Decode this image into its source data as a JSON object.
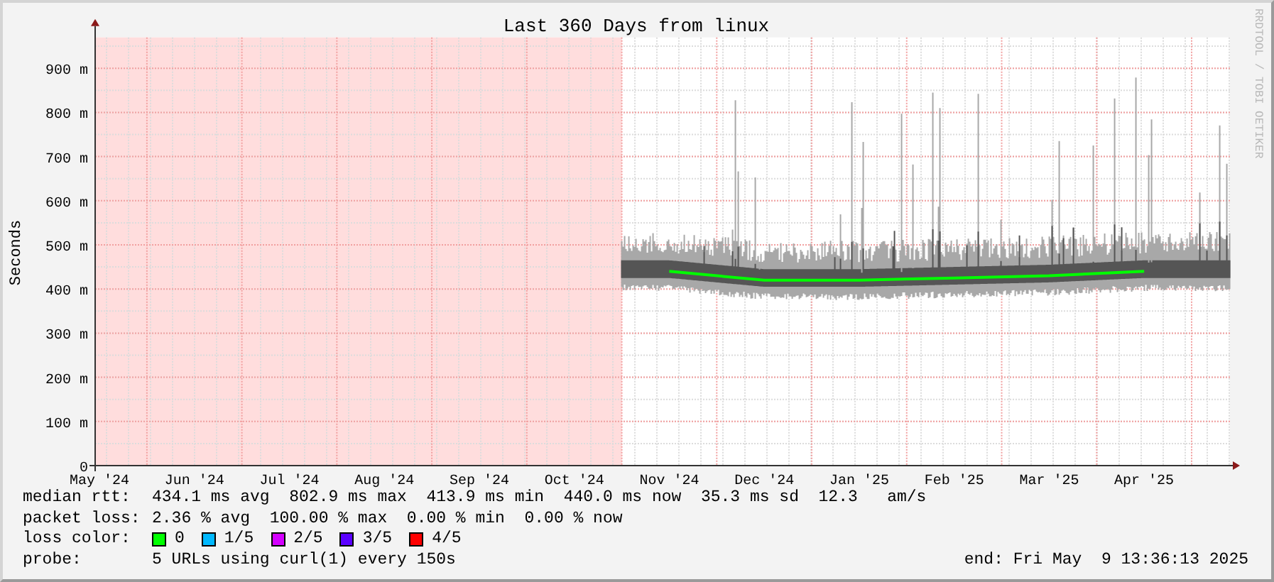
{
  "chart_data": {
    "type": "line",
    "title": "Last 360 Days from linux",
    "ylabel": "Seconds",
    "categories": [
      "May '24",
      "Jun '24",
      "Jul '24",
      "Aug '24",
      "Sep '24",
      "Oct '24",
      "Nov '24",
      "Dec '24",
      "Jan '25",
      "Feb '25",
      "Mar '25",
      "Apr '25"
    ],
    "series": [
      {
        "color": "#00ff00",
        "values": [
          null,
          null,
          null,
          null,
          null,
          null,
          440,
          420,
          420,
          425,
          430,
          440
        ]
      }
    ],
    "ylim": [
      0,
      970
    ],
    "grid": true,
    "yticks": [
      {
        "value": 0,
        "label": "0"
      },
      {
        "value": 100,
        "label": "100 m"
      },
      {
        "value": 200,
        "label": "200 m"
      },
      {
        "value": 300,
        "label": "300 m"
      },
      {
        "value": 400,
        "label": "400 m"
      },
      {
        "value": 500,
        "label": "500 m"
      },
      {
        "value": 600,
        "label": "600 m"
      },
      {
        "value": 700,
        "label": "700 m"
      },
      {
        "value": 800,
        "label": "800 m"
      },
      {
        "value": 900,
        "label": "900 m"
      }
    ]
  },
  "credit": "RRDTOOL / TOBI OETIKER",
  "legend": {
    "median_rtt": {
      "label": "median rtt:",
      "text": "434.1 ms avg  802.9 ms max  413.9 ms min  440.0 ms now  35.3 ms sd  12.3   am/s"
    },
    "packet_loss": {
      "label": "packet loss:",
      "text": "2.36 % avg  100.00 % max  0.00 % min  0.00 % now"
    },
    "loss_color": {
      "label": "loss color:",
      "items": [
        {
          "label": "0",
          "color": "#00ff00"
        },
        {
          "label": "1/5",
          "color": "#00b8ff"
        },
        {
          "label": "2/5",
          "color": "#d400ff"
        },
        {
          "label": "3/5",
          "color": "#5a00ff"
        },
        {
          "label": "4/5",
          "color": "#ff0000"
        }
      ]
    },
    "probe": {
      "label": "probe:",
      "text": "5 URLs using curl(1) every 150s"
    },
    "end": "end: Fri May  9 13:36:13 2025"
  }
}
